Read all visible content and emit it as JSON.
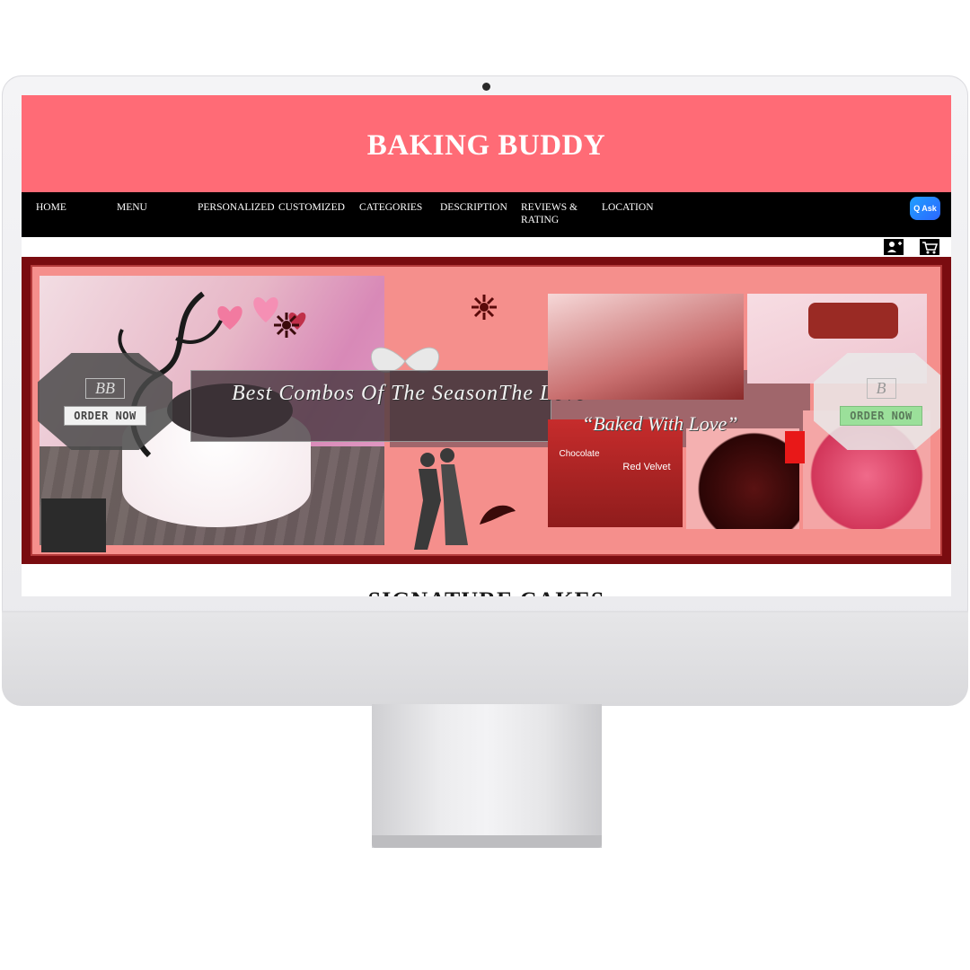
{
  "site": {
    "brand": "BAKING BUDDY"
  },
  "nav": {
    "items": [
      {
        "label": "HOME"
      },
      {
        "label": "MENU"
      },
      {
        "label": "PERSONALIZED"
      },
      {
        "label": "CUSTOMIZED"
      },
      {
        "label": "CATEGORIES"
      },
      {
        "label": "DESCRIPTION"
      },
      {
        "label": "REVIEWS &\nRATING"
      },
      {
        "label": "LOCATION"
      }
    ],
    "ask_label": "Ask",
    "ask_icon": "q-icon"
  },
  "icons": {
    "account": "add-user-icon",
    "cart": "cart-icon"
  },
  "banner": {
    "left_logo": "BB",
    "left_order": "ORDER NOW",
    "right_logo": "B",
    "right_order": "ORDER NOW",
    "tagline_left": "Best Combos Of The SeasonThe Love",
    "tagline_right": "“Baked With Love”",
    "jar1_label": "Chocolate",
    "jar2_label": "Red Velvet"
  },
  "main": {
    "section_title": "SIGNATURE CAKES"
  },
  "colors": {
    "header": "#ff6b76",
    "nav": "#000000",
    "banner_border": "#7a0c10",
    "banner_bg": "#f58f8c",
    "ask_button": "#2c66ff"
  }
}
